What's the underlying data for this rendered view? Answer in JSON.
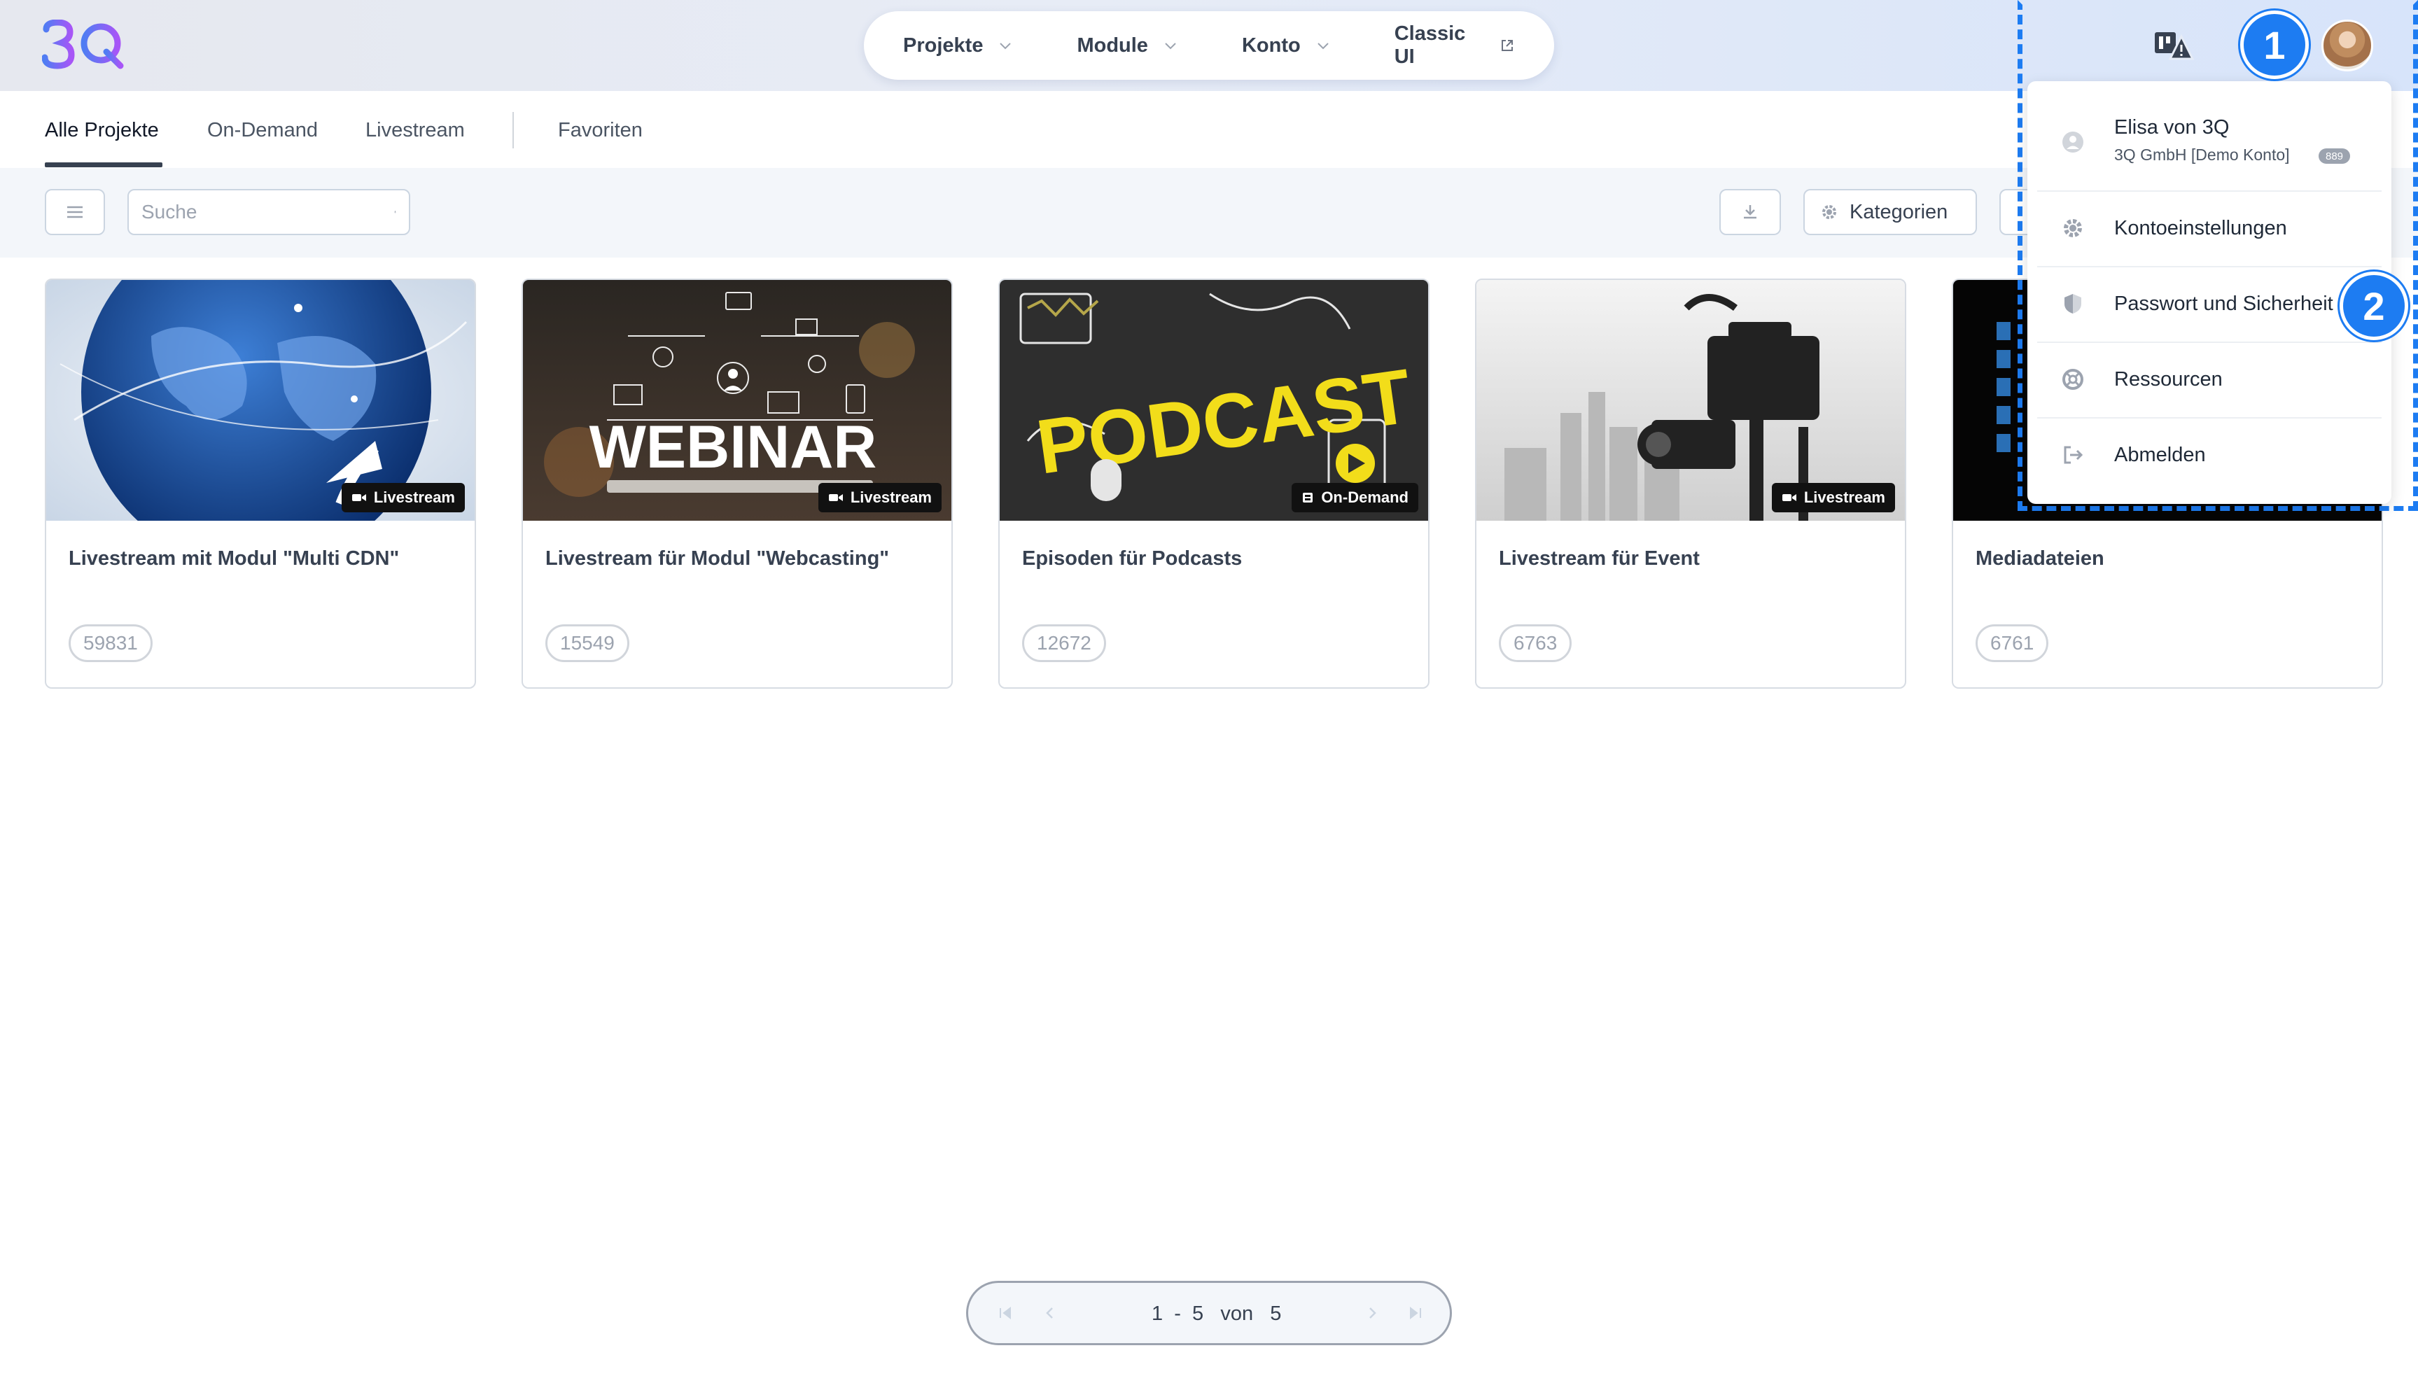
{
  "header": {
    "nav": [
      {
        "label": "Projekte"
      },
      {
        "label": "Module"
      },
      {
        "label": "Konto"
      },
      {
        "label": "Classic UI"
      }
    ]
  },
  "tabs": {
    "all": "Alle Projekte",
    "ondemand": "On-Demand",
    "livestream": "Livestream",
    "favorites": "Favoriten"
  },
  "toolbar": {
    "search_placeholder": "Suche",
    "categories_label": "Kategorien"
  },
  "cards": [
    {
      "title": "Livestream mit Modul \"Multi CDN\"",
      "count": "59831",
      "badge": "Livestream"
    },
    {
      "title": "Livestream für Modul \"Webcasting\"",
      "count": "15549",
      "badge": "Livestream",
      "image_text": "WEBINAR"
    },
    {
      "title": "Episoden für Podcasts",
      "count": "12672",
      "badge": "On-Demand",
      "image_text": "PODCAST"
    },
    {
      "title": "Livestream für Event",
      "count": "6763",
      "badge": "Livestream"
    },
    {
      "title": "Mediadateien",
      "count": "6761"
    }
  ],
  "dropdown": {
    "user_name": "Elisa von 3Q",
    "user_org": "3Q GmbH [Demo Konto]",
    "user_badge": "889",
    "items": [
      {
        "label": "Kontoeinstellungen",
        "icon": "gear-icon"
      },
      {
        "label": "Passwort und Sicherheit",
        "icon": "shield-icon"
      },
      {
        "label": "Ressourcen",
        "icon": "lifebuoy-icon"
      },
      {
        "label": "Abmelden",
        "icon": "logout-icon"
      }
    ]
  },
  "annotations": {
    "first": "1",
    "second": "2"
  },
  "pagination": {
    "from": "1",
    "to": "5",
    "of_label": "von",
    "total": "5"
  },
  "colors": {
    "accent": "#1d7cf2",
    "logo_start": "#3b82f6",
    "logo_end": "#a855f7"
  }
}
